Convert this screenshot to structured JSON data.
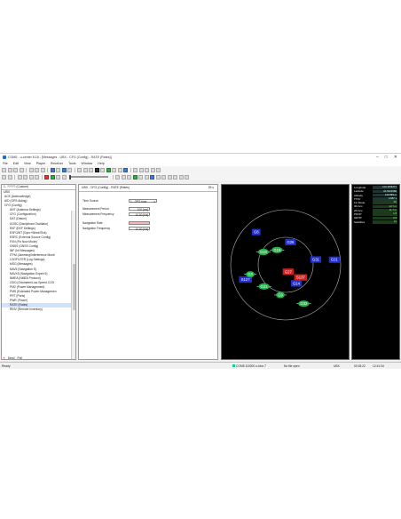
{
  "window": {
    "title": "COM5 - u-center 8.18 - [Messages - UBX - CFG (Config) - RATE (Rates)]",
    "controls": [
      "–",
      "□",
      "✕"
    ]
  },
  "menu": [
    "File",
    "Edit",
    "View",
    "Player",
    "Receiver",
    "Tools",
    "Window",
    "Help"
  ],
  "tree": {
    "combo": "1- ????? (Custom)",
    "root": "UBX",
    "items": [
      {
        "label": "ACK (Acknowledge)",
        "level": 0
      },
      {
        "label": "AID (GPS Aiding)",
        "level": 0
      },
      {
        "label": "CFG (Config)",
        "level": 0
      },
      {
        "label": "ANT (Antenna Settings)",
        "level": 1
      },
      {
        "label": "CFG (Configuration)",
        "level": 1
      },
      {
        "label": "DAT (Datum)",
        "level": 1
      },
      {
        "label": "DOSC (Disciplined Oscillator)",
        "level": 1
      },
      {
        "label": "EKF (EKF Settings)",
        "level": 1
      },
      {
        "label": "ESFGWT (Gyro+WheelTick)",
        "level": 1
      },
      {
        "label": "ESRC (External Source Config)",
        "level": 1
      },
      {
        "label": "FXN (Fix Now Mode)",
        "level": 1
      },
      {
        "label": "GNSS (GNSS Config)",
        "level": 1
      },
      {
        "label": "INF (Inf Messages)",
        "level": 1
      },
      {
        "label": "ITFM (Jamming/Interference Monit",
        "level": 1
      },
      {
        "label": "LOGFILTER (Log Settings)",
        "level": 1
      },
      {
        "label": "MSG (Messages)",
        "level": 1
      },
      {
        "label": "NAV5 (Navigation 5)",
        "level": 1
      },
      {
        "label": "NAVX5 (Navigation Expert 5)",
        "level": 1
      },
      {
        "label": "NMEA (NMEA Protocol)",
        "level": 1
      },
      {
        "label": "ODO (Odometer/Low-Speed COG",
        "level": 1
      },
      {
        "label": "PM2 (Power Management)",
        "level": 1
      },
      {
        "label": "PMS (Extended Power Managemen",
        "level": 1
      },
      {
        "label": "PRT (Ports)",
        "level": 1
      },
      {
        "label": "PWR (Power)",
        "level": 1
      },
      {
        "label": "RATE (Rates)",
        "level": 1,
        "selected": true
      },
      {
        "label": "RINV (Remote Inventory)",
        "level": 1
      }
    ],
    "bottom_buttons": [
      "✕",
      "Send",
      "Poll"
    ]
  },
  "message_view": {
    "header": "UBX - CFG (Config) - RATE (Rates)",
    "rate_label": "25 s",
    "fields": [
      {
        "label": "Time Source",
        "value": "1 - GPS time",
        "kind": "dropdown"
      },
      {
        "label": "Measurement Period",
        "value": "100 [ms]",
        "kind": "input"
      },
      {
        "label": "Measurement Frequency",
        "value": "10.00 [Hz]",
        "kind": "input"
      },
      {
        "label": "Navigation Rate",
        "value": "",
        "kind": "highlight"
      },
      {
        "label": "Navigation Frequency",
        "value": "10.00 [Hz]",
        "kind": "input"
      }
    ]
  },
  "sky_view": {
    "satellites": [
      {
        "id": "G8",
        "color": "#2030d0",
        "az": 318,
        "el": 18
      },
      {
        "id": "G26",
        "color": "#2030d0",
        "az": 12,
        "el": 52
      },
      {
        "id": "G23",
        "color": "#22b44a",
        "az": 300,
        "el": 48
      },
      {
        "id": "G19",
        "color": "#22b44a",
        "az": 330,
        "el": 62
      },
      {
        "id": "G31",
        "color": "#2030d0",
        "az": 80,
        "el": 40
      },
      {
        "id": "G21",
        "color": "#2030d0",
        "az": 84,
        "el": 10
      },
      {
        "id": "S127",
        "color": "#2030d0",
        "az": 250,
        "el": 20
      },
      {
        "id": "G3",
        "color": "#22b44a",
        "az": 255,
        "el": 30
      },
      {
        "id": "S137",
        "color": "#d02020",
        "az": 130,
        "el": 58
      },
      {
        "id": "G27",
        "color": "#d02020",
        "az": 160,
        "el": 78
      },
      {
        "id": "G22",
        "color": "#22b44a",
        "az": 225,
        "el": 40
      },
      {
        "id": "G14",
        "color": "#2030d0",
        "az": 150,
        "el": 55
      },
      {
        "id": "G9",
        "color": "#22b44a",
        "az": 190,
        "el": 40
      },
      {
        "id": "G32",
        "color": "#22b44a",
        "az": 155,
        "el": 20
      }
    ]
  },
  "info_panel": {
    "rows": [
      {
        "label": "Longitude",
        "value": "114.1156471"
      },
      {
        "label": "Latitude",
        "value": "22.5423580"
      },
      {
        "label": "Altitude",
        "value": "140.899 m"
      },
      {
        "label": "TTFF",
        "value": "0.987 s"
      },
      {
        "label": "Fix Mode",
        "value": "3D"
      },
      {
        "label": "3D Acc.",
        "value": "13.7 m"
      },
      {
        "label": "2D Acc.",
        "value": "11.7 m"
      },
      {
        "label": "PDOP",
        "value": "1.8"
      },
      {
        "label": "HDOP",
        "value": "0.9"
      },
      {
        "label": "Satellites",
        "value": "16"
      }
    ]
  },
  "status": {
    "left": "Ready",
    "connection": "COM5 115200 u-blox 7",
    "file": "No file open",
    "protocol": "UBX",
    "elapsed": "00:18:22",
    "clock": "12:41:34"
  },
  "colors": {
    "background": "#f0f0f0",
    "sky_background": "#000000",
    "sat_used": "#22b44a",
    "sat_tracked": "#2030d0",
    "sat_weak": "#d02020"
  }
}
